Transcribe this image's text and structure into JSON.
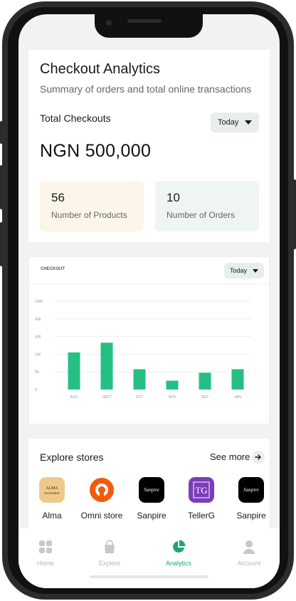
{
  "summary": {
    "title": "Checkout Analytics",
    "subtitle": "Summary of orders and total online transactions",
    "total_label": "Total Checkouts",
    "period": "Today",
    "amount": "NGN 500,000",
    "products": {
      "value": "56",
      "label": "Number of Products"
    },
    "orders": {
      "value": "10",
      "label": "Number of Orders"
    }
  },
  "chart_card": {
    "title": "CHECKOUT",
    "period": "Today"
  },
  "chart_data": {
    "type": "bar",
    "categories": [
      "AUG",
      "SEPT",
      "OCT",
      "NOV",
      "DEC",
      "JAN"
    ],
    "values": [
      21000,
      26500,
      11500,
      5000,
      9500,
      11500
    ],
    "yticks": [
      "0",
      "5K",
      "15K",
      "30K",
      "60K",
      "100K"
    ],
    "ylim": [
      0,
      30000
    ],
    "bar_color": "#25bf84",
    "title": "CHECKOUT"
  },
  "explore": {
    "title": "Explore stores",
    "see_more": "See more",
    "stores": [
      {
        "name": "Alma",
        "logo_text": "ALMA NATASHIA"
      },
      {
        "name": "Omni store",
        "logo_text": ""
      },
      {
        "name": "Sanpire",
        "logo_text": "Sanpire"
      },
      {
        "name": "TellerG",
        "logo_text": "TG"
      },
      {
        "name": "Sanpire",
        "logo_text": "Sanpire"
      }
    ]
  },
  "nav": {
    "items": [
      {
        "label": "Home",
        "icon": "grid-icon"
      },
      {
        "label": "Explore",
        "icon": "bag-icon"
      },
      {
        "label": "Analytics",
        "icon": "pie-chart-icon"
      },
      {
        "label": "Account",
        "icon": "user-icon"
      }
    ],
    "active": "Analytics"
  },
  "colors": {
    "accent": "#1fa672",
    "products_bg": "#fcf5ea",
    "orders_bg": "#eff5f2",
    "dropdown_bg": "#e8efea"
  }
}
